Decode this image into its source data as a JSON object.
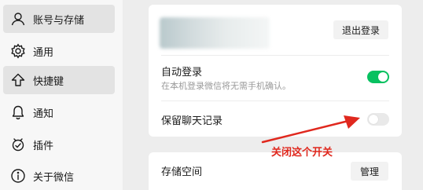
{
  "sidebar": {
    "items": [
      {
        "label": "账号与存储",
        "icon": "person-icon",
        "active": true
      },
      {
        "label": "通用",
        "icon": "gear-icon",
        "active": false
      },
      {
        "label": "快捷键",
        "icon": "arrow-up-icon",
        "active": true
      },
      {
        "label": "通知",
        "icon": "bell-icon",
        "active": false
      },
      {
        "label": "插件",
        "icon": "plugin-icon",
        "active": false
      },
      {
        "label": "关于微信",
        "icon": "info-icon",
        "active": false
      }
    ]
  },
  "account": {
    "logout_label": "退出登录"
  },
  "settings": {
    "auto_login": {
      "title": "自动登录",
      "subtitle": "在本机登录微信将无需手机确认。",
      "enabled": true
    },
    "keep_history": {
      "title": "保留聊天记录",
      "enabled": false
    }
  },
  "storage": {
    "title": "存储空间",
    "manage_label": "管理"
  },
  "annotation": {
    "text": "关闭这个开关",
    "color": "#e0281e"
  },
  "colors": {
    "toggle_on": "#07c160",
    "sidebar_bg": "#f7f7f7",
    "content_bg": "#ededed"
  }
}
